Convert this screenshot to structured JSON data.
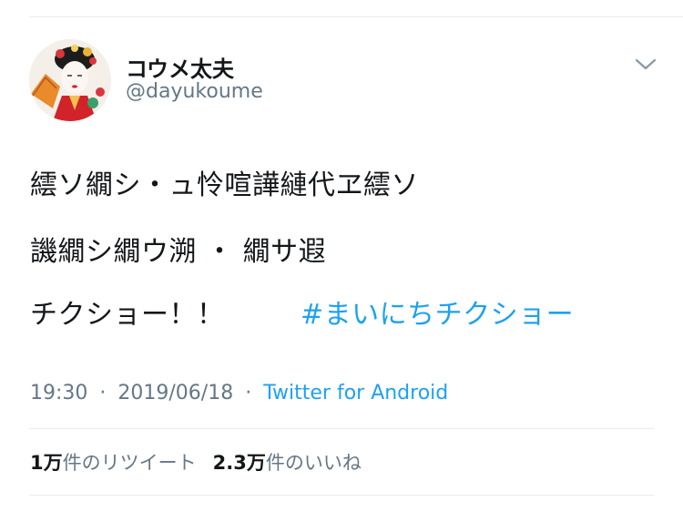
{
  "tweet": {
    "author": {
      "display_name": "コウメ太夫",
      "handle": "@dayukoume",
      "avatar_icon": "avatar-geisha-portrait"
    },
    "menu_icon": "chevron-down-icon",
    "lines": [
      "繧ソ繝シ・ュ怜喧譁縺代ヱ繧ソ",
      "譏繝シ繝ウ溯 ・ 繝サ遐",
      "チクショー！！"
    ],
    "hashtag": "#まいにちチクショー",
    "time": "19:30",
    "separator": "·",
    "date": "2019/06/18",
    "source": "Twitter for Android",
    "retweets": {
      "count": "1万",
      "label": "件のリツイート"
    },
    "likes": {
      "count": "2.3万",
      "label": "件のいいね"
    }
  },
  "colors": {
    "text": "#14171a",
    "secondary": "#657786",
    "link": "#1da1f2",
    "divider": "#e6ecf0"
  }
}
